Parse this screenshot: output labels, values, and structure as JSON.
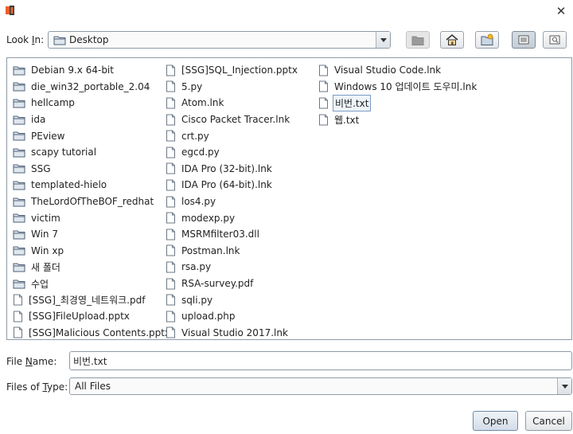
{
  "dialog": {
    "look_in_label_pre": "Look ",
    "look_in_label_mnemonic": "I",
    "look_in_label_post": "n:",
    "look_in_value": "Desktop",
    "file_name_label_pre": "File ",
    "file_name_label_mnemonic": "N",
    "file_name_label_post": "ame:",
    "file_name_value": "비번.txt",
    "files_of_type_label_pre": "Files of ",
    "files_of_type_label_mnemonic": "T",
    "files_of_type_label_post": "ype:",
    "files_of_type_value": "All Files",
    "open_label": "Open",
    "cancel_label": "Cancel",
    "close_glyph": "✕"
  },
  "toolbar": {
    "icons": [
      "up-folder-icon",
      "home-icon",
      "new-folder-icon",
      "list-view-icon",
      "details-view-icon"
    ]
  },
  "colors": {
    "folder": "#5b6f86",
    "accent": "#7a9cc4"
  },
  "files": {
    "col1": [
      {
        "name": "Debian 9.x 64-bit",
        "type": "folder"
      },
      {
        "name": "die_win32_portable_2.04",
        "type": "folder"
      },
      {
        "name": "hellcamp",
        "type": "folder"
      },
      {
        "name": "ida",
        "type": "folder"
      },
      {
        "name": "PEview",
        "type": "folder"
      },
      {
        "name": "scapy tutorial",
        "type": "folder"
      },
      {
        "name": "SSG",
        "type": "folder"
      },
      {
        "name": "templated-hielo",
        "type": "folder"
      },
      {
        "name": "TheLordOfTheBOF_redhat",
        "type": "folder"
      },
      {
        "name": "victim",
        "type": "folder"
      },
      {
        "name": "Win 7",
        "type": "folder"
      },
      {
        "name": "Win xp",
        "type": "folder"
      },
      {
        "name": "새 폴더",
        "type": "folder"
      },
      {
        "name": "수업",
        "type": "folder"
      },
      {
        "name": "[SSG]_최경영_네트워크.pdf",
        "type": "file"
      },
      {
        "name": "[SSG]FileUpload.pptx",
        "type": "file"
      },
      {
        "name": "[SSG]Malicious Contents.pptx",
        "type": "file"
      }
    ],
    "col2": [
      {
        "name": "[SSG]SQL_Injection.pptx",
        "type": "file"
      },
      {
        "name": "5.py",
        "type": "file"
      },
      {
        "name": "Atom.lnk",
        "type": "file"
      },
      {
        "name": "Cisco Packet Tracer.lnk",
        "type": "file"
      },
      {
        "name": "crt.py",
        "type": "file"
      },
      {
        "name": "egcd.py",
        "type": "file"
      },
      {
        "name": "IDA Pro (32-bit).lnk",
        "type": "file"
      },
      {
        "name": "IDA Pro (64-bit).lnk",
        "type": "file"
      },
      {
        "name": "los4.py",
        "type": "file"
      },
      {
        "name": "modexp.py",
        "type": "file"
      },
      {
        "name": "MSRMfilter03.dll",
        "type": "file"
      },
      {
        "name": "Postman.lnk",
        "type": "file"
      },
      {
        "name": "rsa.py",
        "type": "file"
      },
      {
        "name": "RSA-survey.pdf",
        "type": "file"
      },
      {
        "name": "sqli.py",
        "type": "file"
      },
      {
        "name": "upload.php",
        "type": "file"
      },
      {
        "name": "Visual Studio 2017.lnk",
        "type": "file"
      }
    ],
    "col3": [
      {
        "name": "Visual Studio Code.lnk",
        "type": "file"
      },
      {
        "name": "Windows 10 업데이트 도우미.lnk",
        "type": "file"
      },
      {
        "name": "비번.txt",
        "type": "file",
        "selected": true
      },
      {
        "name": "웹.txt",
        "type": "file"
      }
    ]
  }
}
